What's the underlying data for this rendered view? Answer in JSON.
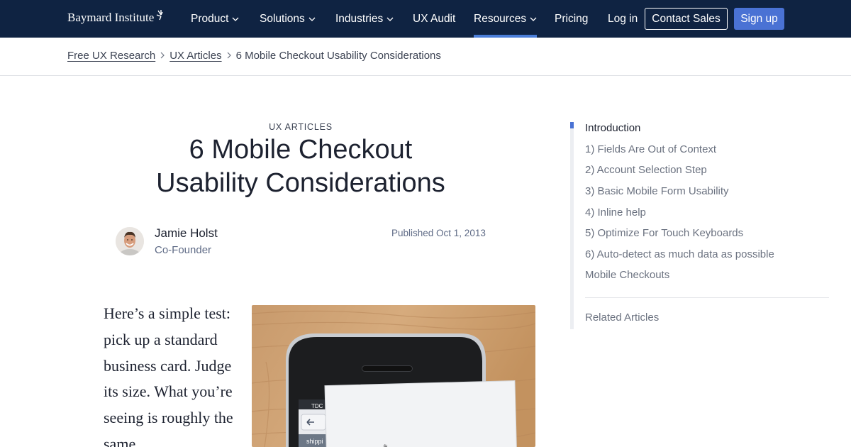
{
  "nav": {
    "logo": "Baymard Institute",
    "items": [
      {
        "label": "Product",
        "dropdown": true
      },
      {
        "label": "Solutions",
        "dropdown": true
      },
      {
        "label": "Industries",
        "dropdown": true
      },
      {
        "label": "UX Audit",
        "dropdown": false
      },
      {
        "label": "Resources",
        "dropdown": true,
        "active": true
      },
      {
        "label": "Pricing",
        "dropdown": false
      },
      {
        "label": "Log in",
        "dropdown": false
      }
    ],
    "contact_label": "Contact Sales",
    "signup_label": "Sign up",
    "colors": {
      "background": "#0f2342",
      "accent": "#4a72d4",
      "active_underline": "#4a7ed9"
    }
  },
  "breadcrumb": {
    "items": [
      "Free UX Research",
      "UX Articles"
    ],
    "current": "6 Mobile Checkout Usability Considerations"
  },
  "article": {
    "kicker": "UX ARTICLES",
    "title_line1": "6 Mobile Checkout",
    "title_line2": "Usability Considerations",
    "author": {
      "name": "Jamie Holst",
      "role": "Co-Founder"
    },
    "published": "Published Oct 1, 2013",
    "lead_text": "Here’s a simple test: pick up a standard business card. Judge its size. What you’re seeing is roughly the same"
  },
  "toc": {
    "items": [
      "Introduction",
      "1) Fields Are Out of Context",
      "2) Account Selection Step",
      "3) Basic Mobile Form Usability",
      "4) Inline help",
      "5) Optimize For Touch Keyboards",
      "6) Auto-detect as much data as possible",
      "Mobile Checkouts"
    ],
    "current_index": 0,
    "related": "Related Articles"
  },
  "photo": {
    "status_text": "TDC",
    "shipping_text": "shippi"
  }
}
